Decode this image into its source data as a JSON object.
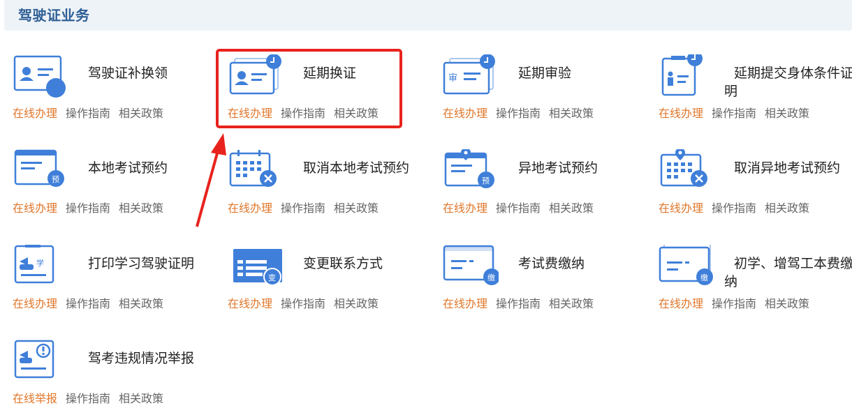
{
  "header": {
    "title": "驾驶证业务"
  },
  "links": {
    "guide": "操作指南",
    "policy": "相关政策"
  },
  "services": [
    {
      "title": "驾驶证补换领",
      "action": "在线办理",
      "icon": "license-card-icon"
    },
    {
      "title": "延期换证",
      "action": "在线办理",
      "icon": "license-clock-icon"
    },
    {
      "title": "延期审验",
      "action": "在线办理",
      "icon": "review-clock-icon"
    },
    {
      "title": "延期提交身体条件证明",
      "action": "在线办理",
      "icon": "health-cert-clock-icon"
    },
    {
      "title": "本地考试预约",
      "action": "在线办理",
      "icon": "local-booking-icon"
    },
    {
      "title": "取消本地考试预约",
      "action": "在线办理",
      "icon": "calendar-cancel-icon"
    },
    {
      "title": "异地考试预约",
      "action": "在线办理",
      "icon": "remote-booking-icon"
    },
    {
      "title": "取消异地考试预约",
      "action": "在线办理",
      "icon": "remote-calendar-cancel-icon"
    },
    {
      "title": "打印学习驾驶证明",
      "action": "在线办理",
      "icon": "learner-print-icon"
    },
    {
      "title": "变更联系方式",
      "action": "在线办理",
      "icon": "contact-change-icon"
    },
    {
      "title": "考试费缴纳",
      "action": "在线办理",
      "icon": "exam-fee-icon"
    },
    {
      "title": "初学、增驾工本费缴纳",
      "action": "在线办理",
      "icon": "fee-payment-icon"
    },
    {
      "title": "驾考违规情况举报",
      "action": "在线举报",
      "icon": "violation-report-icon"
    }
  ]
}
